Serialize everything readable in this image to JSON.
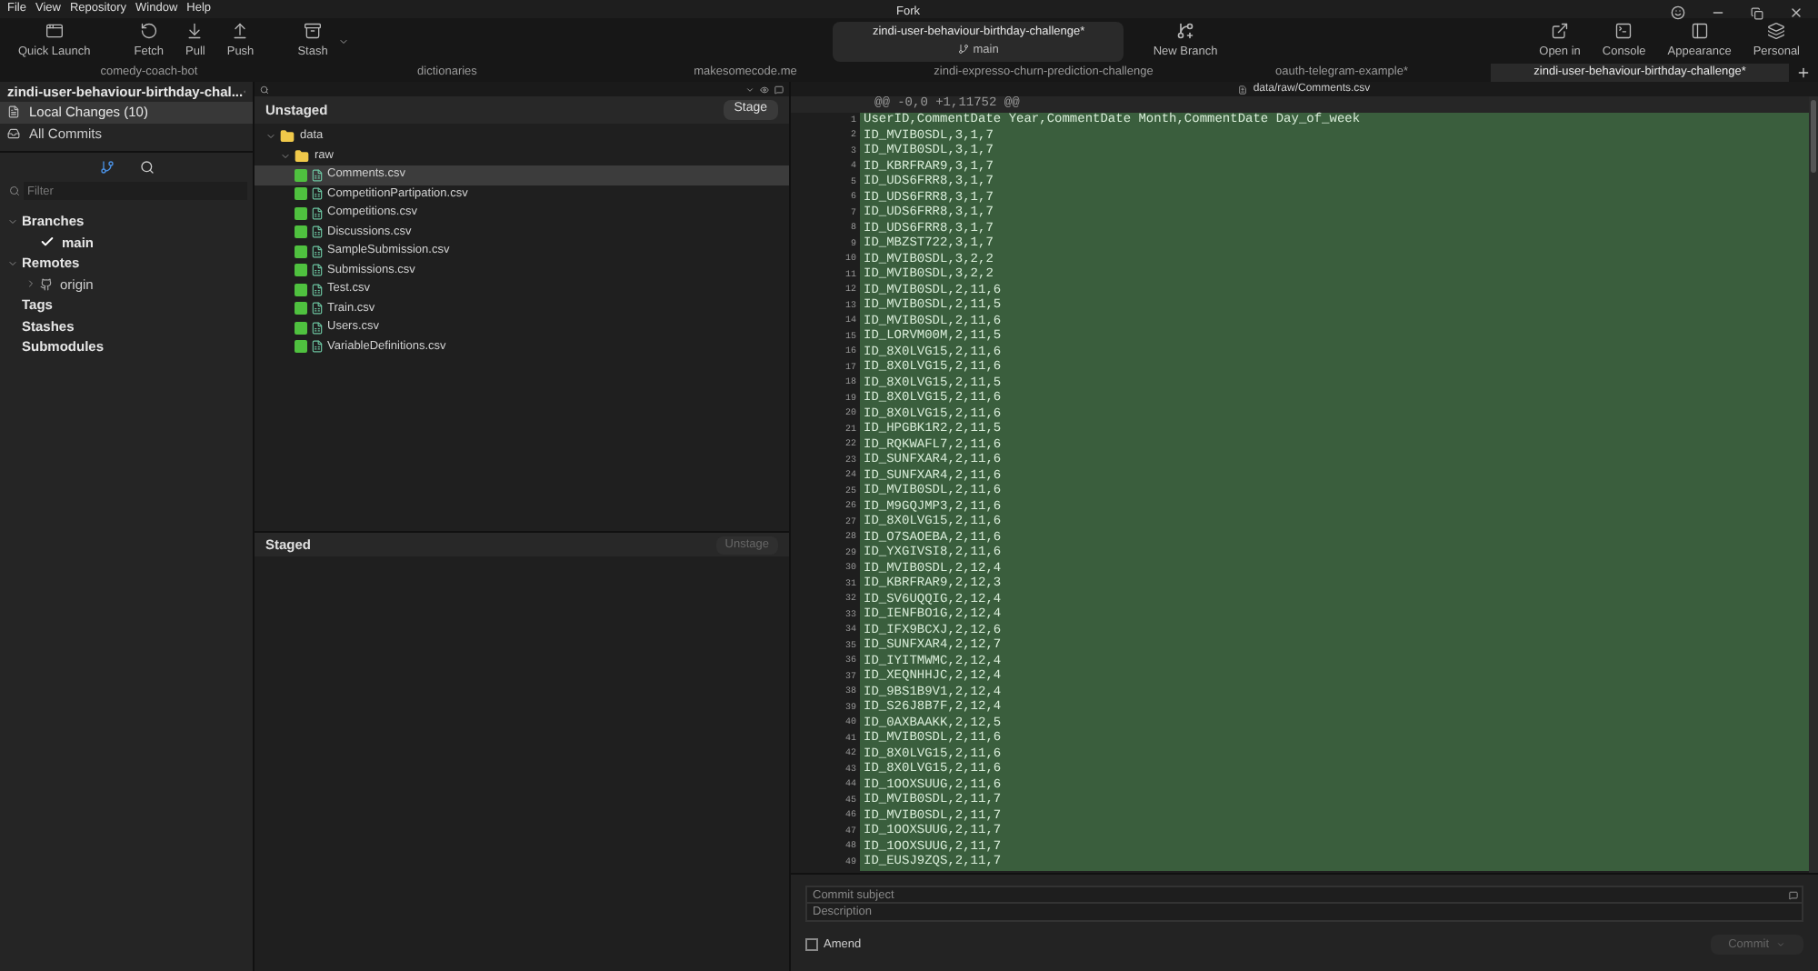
{
  "menu": [
    "File",
    "View",
    "Repository",
    "Window",
    "Help"
  ],
  "window": {
    "title": "Fork"
  },
  "toolbar": {
    "left": [
      {
        "kind": "launch",
        "label": "Quick Launch"
      },
      {
        "kind": "fetch",
        "label": "Fetch"
      },
      {
        "kind": "pull",
        "label": "Pull"
      },
      {
        "kind": "push",
        "label": "Push"
      },
      {
        "kind": "stash",
        "label": "Stash"
      }
    ],
    "repo": {
      "name": "zindi-user-behaviour-birthday-challenge*",
      "branch": "main"
    },
    "new_branch": "New Branch",
    "right": [
      {
        "kind": "open",
        "label": "Open in"
      },
      {
        "kind": "console",
        "label": "Console"
      },
      {
        "kind": "appearance",
        "label": "Appearance"
      },
      {
        "kind": "personal",
        "label": "Personal"
      }
    ]
  },
  "repo_tabs": [
    {
      "label": "comedy-coach-bot",
      "selected": false
    },
    {
      "label": "dictionaries",
      "selected": false
    },
    {
      "label": "makesomecode.me",
      "selected": false
    },
    {
      "label": "zindi-expresso-churn-prediction-challenge",
      "selected": false
    },
    {
      "label": "oauth-telegram-example*",
      "selected": false
    },
    {
      "label": "zindi-user-behaviour-birthday-challenge*",
      "selected": true
    }
  ],
  "sidebar": {
    "repo_name": "zindi-user-behaviour-birthday-chal...",
    "views": [
      {
        "kind": "changes",
        "label": "Local Changes (10)",
        "selected": true
      },
      {
        "kind": "commits",
        "label": "All Commits",
        "selected": false
      }
    ],
    "filter_placeholder": "Filter",
    "tree": [
      {
        "label": "Branches",
        "expanded": true,
        "children": [
          {
            "label": "main",
            "current": true
          }
        ]
      },
      {
        "label": "Remotes",
        "expanded": true,
        "children": [
          {
            "label": "origin",
            "expanded": false,
            "kind": "remote"
          }
        ]
      },
      {
        "label": "Tags"
      },
      {
        "label": "Stashes"
      },
      {
        "label": "Submodules"
      }
    ]
  },
  "unstaged": {
    "title": "Unstaged",
    "button": "Stage",
    "tree": [
      {
        "label": "data",
        "expanded": true,
        "children": [
          {
            "label": "raw",
            "expanded": true,
            "children": [
              {
                "label": "Comments.csv",
                "kind": "added",
                "selected": true
              },
              {
                "label": "CompetitionPartipation.csv",
                "kind": "added",
                "selected": false
              },
              {
                "label": "Competitions.csv",
                "kind": "added",
                "selected": false
              },
              {
                "label": "Discussions.csv",
                "kind": "added",
                "selected": false
              },
              {
                "label": "SampleSubmission.csv",
                "kind": "added",
                "selected": false
              },
              {
                "label": "Submissions.csv",
                "kind": "added",
                "selected": false
              },
              {
                "label": "Test.csv",
                "kind": "added",
                "selected": false
              },
              {
                "label": "Train.csv",
                "kind": "added",
                "selected": false
              },
              {
                "label": "Users.csv",
                "kind": "added",
                "selected": false
              },
              {
                "label": "VariableDefinitions.csv",
                "kind": "added",
                "selected": false
              }
            ]
          }
        ]
      }
    ]
  },
  "staged": {
    "title": "Staged",
    "button": "Unstage",
    "button_disabled": true
  },
  "diff": {
    "path": "data/raw/Comments.csv",
    "hunk": "@@ -0,0 +1,11752 @@",
    "lines": [
      {
        "n": "1",
        "text": "UserID,CommentDate Year,CommentDate Month,CommentDate Day_of_week"
      },
      {
        "n": "2",
        "text": "ID_MVIB0SDL,3,1,7"
      },
      {
        "n": "3",
        "text": "ID_MVIB0SDL,3,1,7"
      },
      {
        "n": "4",
        "text": "ID_KBRFRAR9,3,1,7"
      },
      {
        "n": "5",
        "text": "ID_UDS6FRR8,3,1,7"
      },
      {
        "n": "6",
        "text": "ID_UDS6FRR8,3,1,7"
      },
      {
        "n": "7",
        "text": "ID_UDS6FRR8,3,1,7"
      },
      {
        "n": "8",
        "text": "ID_UDS6FRR8,3,1,7"
      },
      {
        "n": "9",
        "text": "ID_MBZST722,3,1,7"
      },
      {
        "n": "10",
        "text": "ID_MVIB0SDL,3,2,2"
      },
      {
        "n": "11",
        "text": "ID_MVIB0SDL,3,2,2"
      },
      {
        "n": "12",
        "text": "ID_MVIB0SDL,2,11,6"
      },
      {
        "n": "13",
        "text": "ID_MVIB0SDL,2,11,5"
      },
      {
        "n": "14",
        "text": "ID_MVIB0SDL,2,11,6"
      },
      {
        "n": "15",
        "text": "ID_LORVM00M,2,11,5"
      },
      {
        "n": "16",
        "text": "ID_8X0LVG15,2,11,6"
      },
      {
        "n": "17",
        "text": "ID_8X0LVG15,2,11,6"
      },
      {
        "n": "18",
        "text": "ID_8X0LVG15,2,11,5"
      },
      {
        "n": "19",
        "text": "ID_8X0LVG15,2,11,6"
      },
      {
        "n": "20",
        "text": "ID_8X0LVG15,2,11,6"
      },
      {
        "n": "21",
        "text": "ID_HPGBK1R2,2,11,5"
      },
      {
        "n": "22",
        "text": "ID_RQKWAFL7,2,11,6"
      },
      {
        "n": "23",
        "text": "ID_SUNFXAR4,2,11,6"
      },
      {
        "n": "24",
        "text": "ID_SUNFXAR4,2,11,6"
      },
      {
        "n": "25",
        "text": "ID_MVIB0SDL,2,11,6"
      },
      {
        "n": "26",
        "text": "ID_M9GQJMP3,2,11,6"
      },
      {
        "n": "27",
        "text": "ID_8X0LVG15,2,11,6"
      },
      {
        "n": "28",
        "text": "ID_O7SAOEBA,2,11,6"
      },
      {
        "n": "29",
        "text": "ID_YXGIVSI8,2,11,6"
      },
      {
        "n": "30",
        "text": "ID_MVIB0SDL,2,12,4"
      },
      {
        "n": "31",
        "text": "ID_KBRFRAR9,2,12,3"
      },
      {
        "n": "32",
        "text": "ID_SV6UQQIG,2,12,4"
      },
      {
        "n": "33",
        "text": "ID_IENFBO1G,2,12,4"
      },
      {
        "n": "34",
        "text": "ID_IFX9BCXJ,2,12,6"
      },
      {
        "n": "35",
        "text": "ID_SUNFXAR4,2,12,7"
      },
      {
        "n": "36",
        "text": "ID_IYITMWMC,2,12,4"
      },
      {
        "n": "37",
        "text": "ID_XEQNHHJC,2,12,4"
      },
      {
        "n": "38",
        "text": "ID_9BS1B9V1,2,12,4"
      },
      {
        "n": "39",
        "text": "ID_S26J8B7F,2,12,4"
      },
      {
        "n": "40",
        "text": "ID_0AXBAAKK,2,12,5"
      },
      {
        "n": "41",
        "text": "ID_MVIB0SDL,2,11,6"
      },
      {
        "n": "42",
        "text": "ID_8X0LVG15,2,11,6"
      },
      {
        "n": "43",
        "text": "ID_8X0LVG15,2,11,6"
      },
      {
        "n": "44",
        "text": "ID_1OOXSUUG,2,11,6"
      },
      {
        "n": "45",
        "text": "ID_MVIB0SDL,2,11,7"
      },
      {
        "n": "46",
        "text": "ID_MVIB0SDL,2,11,7"
      },
      {
        "n": "47",
        "text": "ID_1OOXSUUG,2,11,7"
      },
      {
        "n": "48",
        "text": "ID_1OOXSUUG,2,11,7"
      },
      {
        "n": "49",
        "text": "ID_EUSJ9ZQS,2,11,7"
      }
    ]
  },
  "commit": {
    "subject_placeholder": "Commit subject",
    "description_placeholder": "Description",
    "amend": {
      "label": "Amend",
      "checked": false
    },
    "button": "Commit",
    "button_disabled": true
  }
}
